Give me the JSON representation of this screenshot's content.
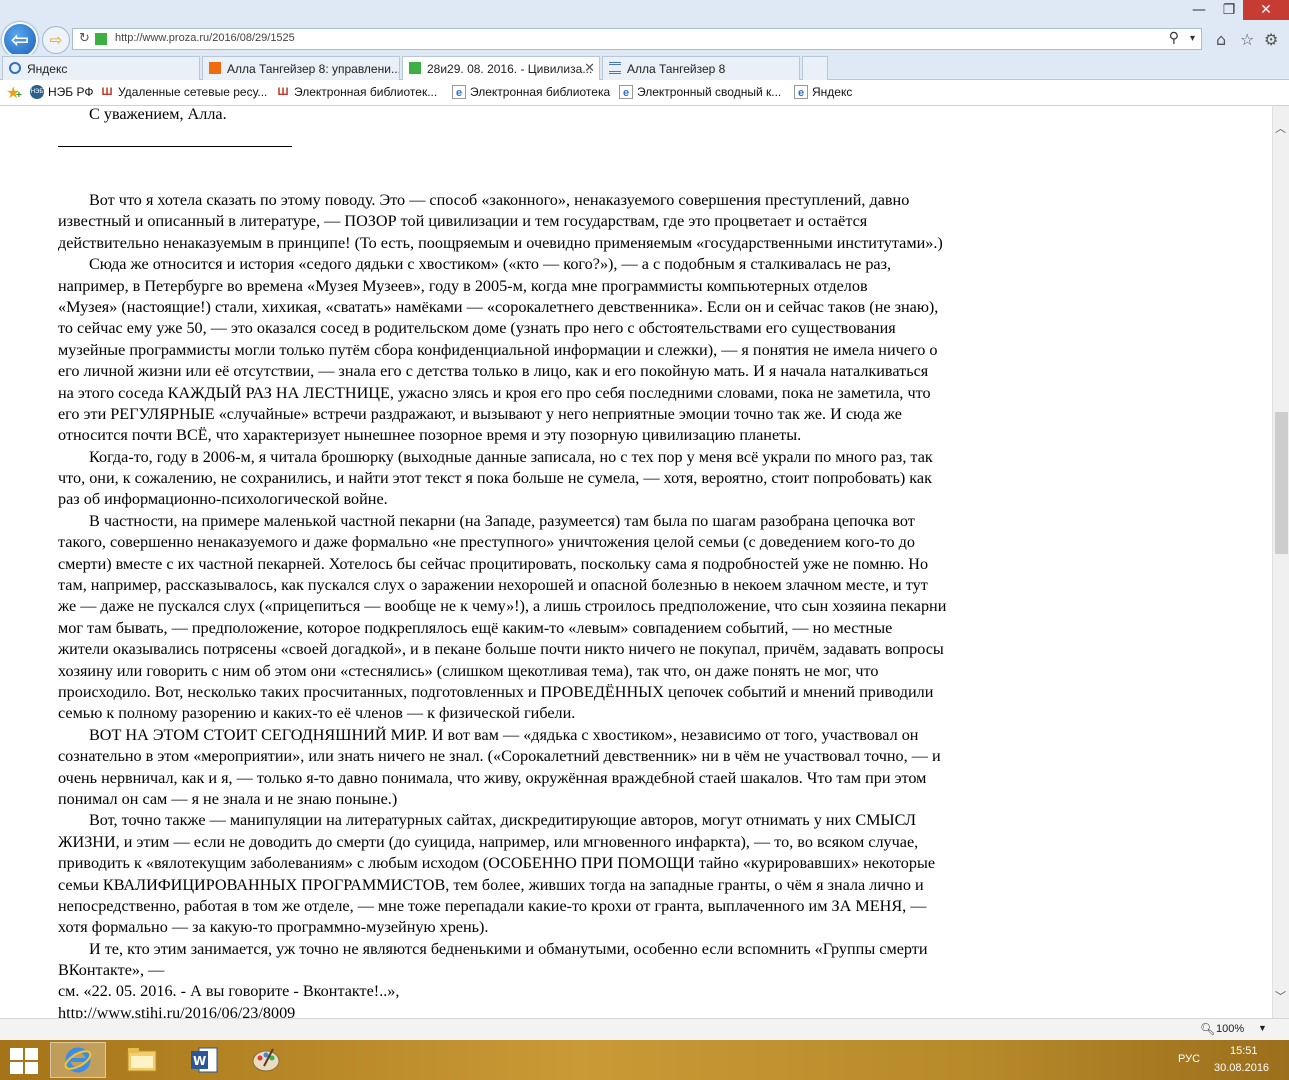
{
  "browser": {
    "url": "http://www.proza.ru/2016/08/29/1525",
    "window_controls": {
      "minimize": "—",
      "maximize": "❐",
      "close": "✕"
    }
  },
  "tabs": [
    {
      "label": "Яндекс",
      "icon_color": "#2f6fcf",
      "active": false
    },
    {
      "label": "Алла Тангейзер 8: управлени...",
      "icon_color": "#f06a10",
      "active": false
    },
    {
      "label": "28и29. 08. 2016. - Цивилиза...",
      "icon_color": "#3cb043",
      "active": true
    },
    {
      "label": "Алла Тангейзер 8",
      "icon_color": "#4a76c2",
      "active": false
    }
  ],
  "favorites": [
    {
      "label": "НЭБ РФ",
      "icon": "НЭБ"
    },
    {
      "label": "Удаленные сетевые ресу...",
      "icon": "Ш"
    },
    {
      "label": "Электронная библиотек...",
      "icon": "Ш"
    },
    {
      "label": "Электронная библиотека",
      "icon": "e"
    },
    {
      "label": "Электронный сводный к...",
      "icon": "e"
    },
    {
      "label": "Яндекс",
      "icon": "e"
    }
  ],
  "article": {
    "signature": "С уважением, Алла.",
    "lines": [
      {
        "t": "Вот что я хотела сказать по этому поводу. Это — способ «законного», ненаказуемого совершения преступлений, давно",
        "i": true
      },
      {
        "t": "известный и описанный в литературе, — ПОЗОР той цивилизации и тем государствам, где это процветает и остаётся",
        "i": false
      },
      {
        "t": "действительно ненаказуемым в принципе! (То есть, поощряемым и очевидно применяемым «государственными институтами».)",
        "i": false
      },
      {
        "t": "Сюда же относится и история «седого дядьки с хвостиком» («кто — кого?»), — а с подобным я сталкивалась не раз,",
        "i": true
      },
      {
        "t": "например, в Петербурге во времена «Музея Музеев», году в 2005-м, когда мне программисты компьютерных отделов",
        "i": false
      },
      {
        "t": "«Музея» (настоящие!) стали, хихикая, «сватать» намёками — «сорокалетнего девственника». Если он и сейчас таков (не знаю),",
        "i": false
      },
      {
        "t": "то сейчас ему уже 50, — это оказался сосед в родительском доме (узнать про него с обстоятельствами его существования",
        "i": false
      },
      {
        "t": "музейные программисты могли только путём сбора конфиденциальной информации и слежки), — я понятия не имела ничего о",
        "i": false
      },
      {
        "t": "его личной жизни или её отсутствии, — знала его с детства только в лицо, как и его покойную мать. И я начала наталкиваться",
        "i": false
      },
      {
        "t": "на этого соседа КАЖДЫЙ РАЗ НА ЛЕСТНИЦЕ, ужасно злясь и кроя его про себя последними словами, пока не заметила, что",
        "i": false
      },
      {
        "t": "его эти РЕГУЛЯРНЫЕ «случайные» встречи раздражают, и вызывают у него неприятные эмоции точно так же. И сюда же",
        "i": false
      },
      {
        "t": "относится почти ВСЁ, что характеризует нынешнее позорное время и эту позорную цивилизацию планеты.",
        "i": false
      },
      {
        "t": "Когда-то, году в 2006-м, я читала брошюрку (выходные данные записала, но с тех пор у меня всё украли по много раз, так",
        "i": true
      },
      {
        "t": "что, они, к сожалению, не сохранились, и найти этот текст я пока больше не сумела, — хотя, вероятно, стоит попробовать) как",
        "i": false
      },
      {
        "t": "раз об информационно-психологической войне.",
        "i": false
      },
      {
        "t": "В частности, на примере маленькой частной пекарни (на Западе, разумеется) там была по шагам разобрана цепочка вот",
        "i": true
      },
      {
        "t": "такого, совершенно ненаказуемого и даже формально «не преступного» уничтожения целой семьи (с доведением кого-то до",
        "i": false
      },
      {
        "t": "смерти) вместе с их частной пекарней. Хотелось бы сейчас процитировать, поскольку сама я подробностей уже не помню. Но",
        "i": false
      },
      {
        "t": "там, например, рассказывалось, как пускался слух о заражении нехорошей и опасной болезнью в некоем злачном месте, и тут",
        "i": false
      },
      {
        "t": "же — даже не пускался слух («прицепиться — вообще не к чему»!), а лишь строилось предположение, что сын хозяина пекарни",
        "i": false
      },
      {
        "t": "мог там бывать, — предположение, которое подкреплялось ещё каким-то «левым» совпадением событий, — но местные",
        "i": false
      },
      {
        "t": "жители оказывались потрясены «своей догадкой», и в пекане больше почти никто ничего не покупал, причём, задавать вопросы",
        "i": false
      },
      {
        "t": "хозяину или говорить с ним об этом они «стеснялись» (слишком щекотливая тема), так что, он даже понять не мог, что",
        "i": false
      },
      {
        "t": "происходило. Вот, несколько таких просчитанных, подготовленных и ПРОВЕДЁННЫХ цепочек событий и мнений приводили",
        "i": false
      },
      {
        "t": "семью к полному разорению и каких-то её членов — к физической гибели.",
        "i": false
      },
      {
        "t": "ВОТ НА ЭТОМ СТОИТ СЕГОДНЯШНИЙ МИР. И вот вам — «дядька с хвостиком», независимо от того, участвовал он",
        "i": true
      },
      {
        "t": "сознательно в этом «мероприятии», или знать ничего не знал. («Сорокалетний девственник» ни в чём не участвовал точно, — и",
        "i": false
      },
      {
        "t": "очень нервничал, как и я, — только я-то давно понимала, что живу, окружённая враждебной стаей шакалов. Что там при этом",
        "i": false
      },
      {
        "t": "понимал он сам — я не знала и не знаю поныне.)",
        "i": false
      },
      {
        "t": "Вот, точно также — манипуляции на литературных сайтах, дискредитирующие авторов, могут отнимать у них СМЫСЛ",
        "i": true
      },
      {
        "t": "ЖИЗНИ, и этим — если не доводить до смерти (до суицида, например, или мгновенного инфаркта), — то, во всяком случае,",
        "i": false
      },
      {
        "t": "приводить к «вялотекущим заболеваниям» с любым исходом (ОСОБЕННО ПРИ ПОМОЩИ тайно «курировавших» некоторые",
        "i": false
      },
      {
        "t": "семьи КВАЛИФИЦИРОВАННЫХ ПРОГРАММИСТОВ, тем более, живших тогда на западные гранты, о чём я знала лично и",
        "i": false
      },
      {
        "t": "непосредственно, работая в том же отделе, — мне тоже перепадали какие-то крохи от гранта, выплаченного им ЗА МЕНЯ, —",
        "i": false
      },
      {
        "t": "хотя формально — за какую-то программно-музейную хрень).",
        "i": false
      },
      {
        "t": "И те, кто этим занимается, уж точно не являются бедненькими и обманутыми, особенно если вспомнить «Группы смерти",
        "i": true
      },
      {
        "t": "ВКонтакте», —",
        "i": false
      },
      {
        "t": "см. «22. 05. 2016. - А вы говорите - Вконтакте!..»,",
        "i": false
      },
      {
        "t": "http://www.stihi.ru/2016/06/23/8009",
        "i": false
      }
    ]
  },
  "status_bar": {
    "zoom": "100%"
  },
  "taskbar": {
    "language": "РУС",
    "time": "15:51",
    "date": "30.08.2016"
  }
}
